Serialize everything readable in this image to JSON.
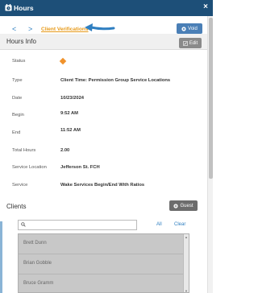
{
  "window": {
    "title": "Hours",
    "close_glyph": "×"
  },
  "nav": {
    "prev_glyph": "<",
    "next_glyph": ">",
    "link_label": "Client Verifications"
  },
  "buttons": {
    "void_label": "Void",
    "edit_label": "Edit",
    "guest_label": "Guest"
  },
  "hours_info": {
    "header": "Hours Info",
    "rows": [
      {
        "label": "Status",
        "value": ""
      },
      {
        "label": "Type",
        "value": "Client Time: Permission Group Service Locations"
      },
      {
        "label": "Date",
        "value": "10/23/2024"
      },
      {
        "label": "Begin",
        "value": "9:52 AM"
      },
      {
        "label": "End",
        "value": "11:52 AM"
      },
      {
        "label": "Total Hours",
        "value": "2.00"
      },
      {
        "label": "Service Location",
        "value": "Jefferson St. FCH"
      },
      {
        "label": "Service",
        "value": "Wake Services Begin/End With Ratios"
      }
    ],
    "status_color": "#f0922b"
  },
  "clients": {
    "header": "Clients",
    "search_value": "",
    "all_label": "All",
    "clear_label": "Clear",
    "items": [
      "Brett Dunn",
      "Brian Gobble",
      "Bruce Gramm"
    ]
  },
  "colors": {
    "titlebar": "#1d4f78",
    "accent": "#2f7fc1",
    "link_orange": "#e79a1a"
  },
  "icons": {
    "app": "clock-icon",
    "void": "x-circle-icon",
    "edit": "pencil-icon",
    "guest": "plus-icon",
    "search": "search-icon"
  }
}
